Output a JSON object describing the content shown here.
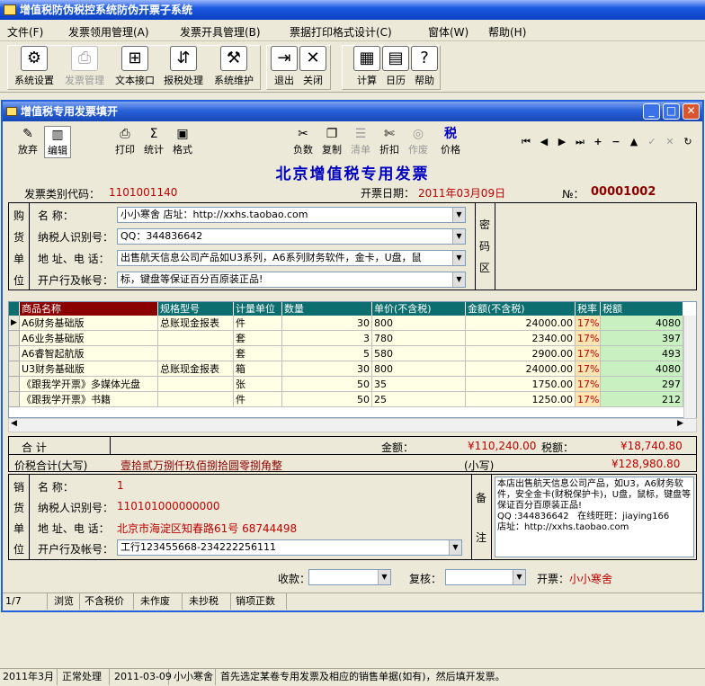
{
  "app": {
    "title": "增值税防伪税控系统防伪开票子系统"
  },
  "menu": [
    {
      "label": "文件(F)"
    },
    {
      "label": "发票领用管理(A)"
    },
    {
      "label": "发票开具管理(B)"
    },
    {
      "label": "票据打印格式设计(C)"
    },
    {
      "label": "窗体(W)"
    },
    {
      "label": "帮助(H)"
    }
  ],
  "toolbar": {
    "groups": [
      {
        "items": [
          {
            "label": "系统设置",
            "icon": "settings-icon",
            "glyph": "⚙"
          },
          {
            "label": "发票管理",
            "icon": "printer-icon",
            "glyph": "⎙"
          },
          {
            "label": "文本接口",
            "icon": "network-icon",
            "glyph": "⊞"
          },
          {
            "label": "报税处理",
            "icon": "tax-report-icon",
            "glyph": "⇵"
          },
          {
            "label": "系统维护",
            "icon": "maintenance-icon",
            "glyph": "⚒"
          }
        ]
      },
      {
        "items": [
          {
            "label": "退出",
            "icon": "exit-icon",
            "glyph": "⇥"
          },
          {
            "label": "关闭",
            "icon": "close-icon",
            "glyph": "✕"
          }
        ]
      },
      {
        "items": [
          {
            "label": "计算",
            "icon": "calculator-icon",
            "glyph": "▦"
          },
          {
            "label": "日历",
            "icon": "calendar-icon",
            "glyph": "▤"
          },
          {
            "label": "帮助",
            "icon": "help-book-icon",
            "glyph": "?"
          }
        ]
      }
    ]
  },
  "child": {
    "title": "增值税专用发票填开",
    "tools": [
      {
        "label": "放弃",
        "glyph": "✎"
      },
      {
        "label": "编辑",
        "glyph": "▥"
      },
      {
        "label": "打印",
        "glyph": "⎙"
      },
      {
        "label": "统计",
        "glyph": "Σ"
      },
      {
        "label": "格式",
        "glyph": "▣"
      },
      {
        "label": "负数",
        "glyph": "✂"
      },
      {
        "label": "复制",
        "glyph": "❐"
      },
      {
        "label": "清单",
        "glyph": "☰"
      },
      {
        "label": "折扣",
        "glyph": "✄"
      },
      {
        "label": "作废",
        "glyph": "◎"
      },
      {
        "label": "价格",
        "glyph": "税"
      }
    ],
    "nav": [
      "⏮",
      "◀",
      "▶",
      "⏭",
      "+",
      "−",
      "▲",
      "✓",
      "✕",
      "↻"
    ]
  },
  "invoice": {
    "heading": "北京增值税专用发票",
    "type_label": "发票类别代码：",
    "type_code": "1101001140",
    "date_label": "开票日期：",
    "date": "2011年03月09日",
    "no_label": "№：",
    "no": "00001002"
  },
  "buyer": {
    "vlabel": [
      "购",
      "货",
      "单",
      "位"
    ],
    "name_label": "名      称：",
    "name": "小小寒舍 店址：http://xxhs.taobao.com",
    "tax_label": "纳税人识别号：",
    "tax_id": "QQ：344836642",
    "addr_label": "地 址、电 话：",
    "addr": "出售航天信息公司产品如U3系列，A6系列财务软件，金卡，U盘，鼠",
    "bank_label": "开户行及帐号：",
    "bank": "标，键盘等保证百分百原装正品!",
    "secret_label": [
      "密",
      "码",
      "区"
    ]
  },
  "grid": {
    "headers": [
      "商品名称",
      "规格型号",
      "计量单位",
      "数量",
      "单价(不含税)",
      "金额(不含税)",
      "税率",
      "税额"
    ],
    "rows": [
      [
        "A6财务基础版",
        "总账现金报表",
        "件",
        "30",
        "800",
        "24000.00",
        "17%",
        "4080"
      ],
      [
        "A6业务基础版",
        "",
        "套",
        "3",
        "780",
        "2340.00",
        "17%",
        "397"
      ],
      [
        "A6睿智起航版",
        "",
        "套",
        "5",
        "580",
        "2900.00",
        "17%",
        "493"
      ],
      [
        "U3财务基础版",
        "总账现金报表",
        "箱",
        "30",
        "800",
        "24000.00",
        "17%",
        "4080"
      ],
      [
        "《跟我学开票》多媒体光盘",
        "",
        "张",
        "50",
        "35",
        "1750.00",
        "17%",
        "297"
      ],
      [
        "《跟我学开票》书籍",
        "",
        "件",
        "50",
        "25",
        "1250.00",
        "17%",
        "212"
      ]
    ]
  },
  "totals": {
    "label": "合          计",
    "amount_label": "金额：",
    "amount": "¥110,240.00",
    "tax_label": "税额：",
    "tax": "¥18,740.80",
    "upper_label": "价税合计(大写)",
    "upper": "壹拾贰万捌仟玖佰捌拾圆零捌角整",
    "small_label": "(小写)",
    "small": "¥128,980.80"
  },
  "seller": {
    "vlabel": [
      "销",
      "货",
      "单",
      "位"
    ],
    "name_label": "名      称：",
    "name": "1",
    "tax_label": "纳税人识别号：",
    "tax_id": "110101000000000",
    "addr_label": "地 址、电 话：",
    "addr": "北京市海淀区知春路61号 68744498",
    "bank_label": "开户行及帐号：",
    "bank": "工行123455668-234222256111",
    "remark_label": [
      "备",
      "注"
    ],
    "remark": "本店出售航天信息公司产品，如U3，A6财务软件，安全金卡(财税保护卡)，U盘，鼠标，键盘等保证百分百原装正品!\nQQ :344836642   在线旺旺：jiaying166\n店址：http://xxhs.taobao.com"
  },
  "signers": {
    "payee_label": "收款：",
    "review_label": "复核：",
    "drawer_label": "开票：",
    "drawer": "小小寒舍"
  },
  "child_status": [
    "1/7",
    "浏览",
    "不含税价",
    "未作废",
    "未抄税",
    "销项正数"
  ],
  "status": [
    "2011年3月",
    "正常处理",
    "2011-03-09",
    "小小寒舍",
    "首先选定某卷专用发票及相应的销售单据(如有)，然后填开发票。"
  ]
}
